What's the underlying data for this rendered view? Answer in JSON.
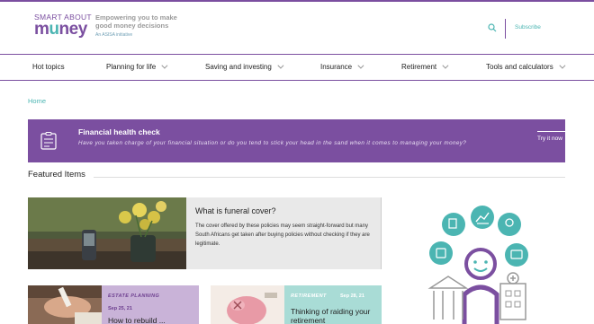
{
  "brand": {
    "logo_line1": "SMART ABOUT",
    "logo_line2a": "m",
    "logo_line2b": "u",
    "logo_line2c": "ney",
    "tagline": "Empowering you to make good money decisions",
    "sub_tagline": "An ASISA initiative",
    "colors": {
      "purple": "#7b4fa0",
      "teal": "#4bb5b2"
    }
  },
  "header": {
    "search_icon": "search-icon",
    "subscribe_label": "Subscribe"
  },
  "nav": {
    "items": [
      {
        "label": "Hot topics",
        "has_dropdown": false
      },
      {
        "label": "Planning for life",
        "has_dropdown": true
      },
      {
        "label": "Saving and investing",
        "has_dropdown": true
      },
      {
        "label": "Insurance",
        "has_dropdown": true
      },
      {
        "label": "Retirement",
        "has_dropdown": true
      },
      {
        "label": "Tools and calculators",
        "has_dropdown": true
      }
    ]
  },
  "breadcrumb": {
    "home": "Home"
  },
  "banner": {
    "icon": "checklist-icon",
    "title": "Financial health check",
    "text": "Have you taken charge of your financial situation or do you tend to stick your head in the sand when it comes to managing your money?",
    "cta": "Try it now"
  },
  "featured": {
    "heading": "Featured Items",
    "main": {
      "title": "What is funeral cover?",
      "body": "The cover offered by these policies may seem straight-forward but many South Africans get taken after buying policies without checking if they are legitimate."
    },
    "cards": [
      {
        "category": "ESTATE PLANNING",
        "date": "Sep 25, 21",
        "title": "How to rebuild ... ",
        "bg": "#c9b3d8"
      },
      {
        "category": "RETIREMENT",
        "date": "Sep 28, 21",
        "title": "Thinking of raiding your retirement",
        "bg": "#a9dcd6"
      }
    ]
  }
}
